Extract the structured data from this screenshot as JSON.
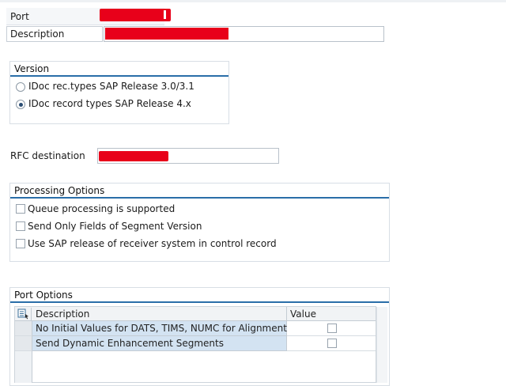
{
  "header": {
    "port_label": "Port",
    "description_label": "Description"
  },
  "version_group": {
    "title": "Version",
    "options": [
      {
        "label": "IDoc rec.types SAP Release 3.0/3.1",
        "selected": false
      },
      {
        "label": "IDoc record types SAP Release 4.x",
        "selected": true
      }
    ]
  },
  "rfc": {
    "label": "RFC destination"
  },
  "processing_group": {
    "title": "Processing Options",
    "options": [
      {
        "label": "Queue processing is supported",
        "checked": false
      },
      {
        "label": "Send Only Fields of Segment Version",
        "checked": false
      },
      {
        "label": "Use SAP release of receiver system in control record",
        "checked": false
      }
    ]
  },
  "port_options": {
    "title": "Port Options",
    "columns": [
      "Description",
      "Value"
    ],
    "rows": [
      {
        "description": "No Initial Values for DATS, TIMS, NUMC for Alignment",
        "value": false
      },
      {
        "description": "Send Dynamic Enhancement Segments",
        "value": false
      }
    ]
  },
  "colors": {
    "accent": "#2a6ea8",
    "redaction": "#e8001a",
    "row_selected": "#d3e3f2"
  }
}
